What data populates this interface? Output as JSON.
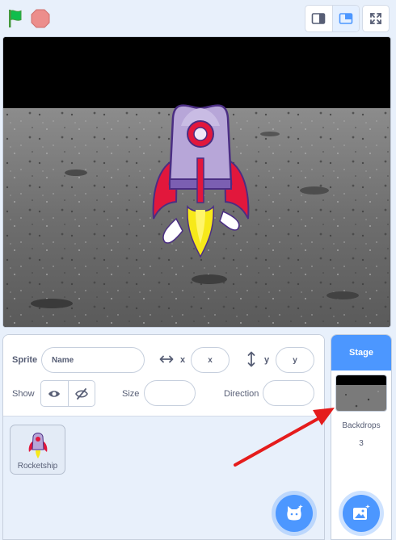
{
  "controls": {
    "green_flag_icon": "green-flag-icon",
    "stop_icon": "stop-icon",
    "layout_modes": [
      "small-stage",
      "normal-stage"
    ],
    "active_layout_mode": "normal-stage"
  },
  "sprite_info": {
    "sprite_label": "Sprite",
    "name_placeholder": "Name",
    "x_label": "x",
    "x_placeholder": "x",
    "y_label": "y",
    "y_placeholder": "y",
    "show_label": "Show",
    "size_label": "Size",
    "direction_label": "Direction"
  },
  "sprites": [
    {
      "name": "Rocketship"
    }
  ],
  "stage_panel": {
    "header": "Stage",
    "backdrops_label": "Backdrops",
    "backdrops_count": "3"
  },
  "colors": {
    "accent": "#4c97ff",
    "green_flag": "#0fbd4c",
    "stop": "#ec8e8c",
    "annotation_arrow": "#e51c1c"
  }
}
